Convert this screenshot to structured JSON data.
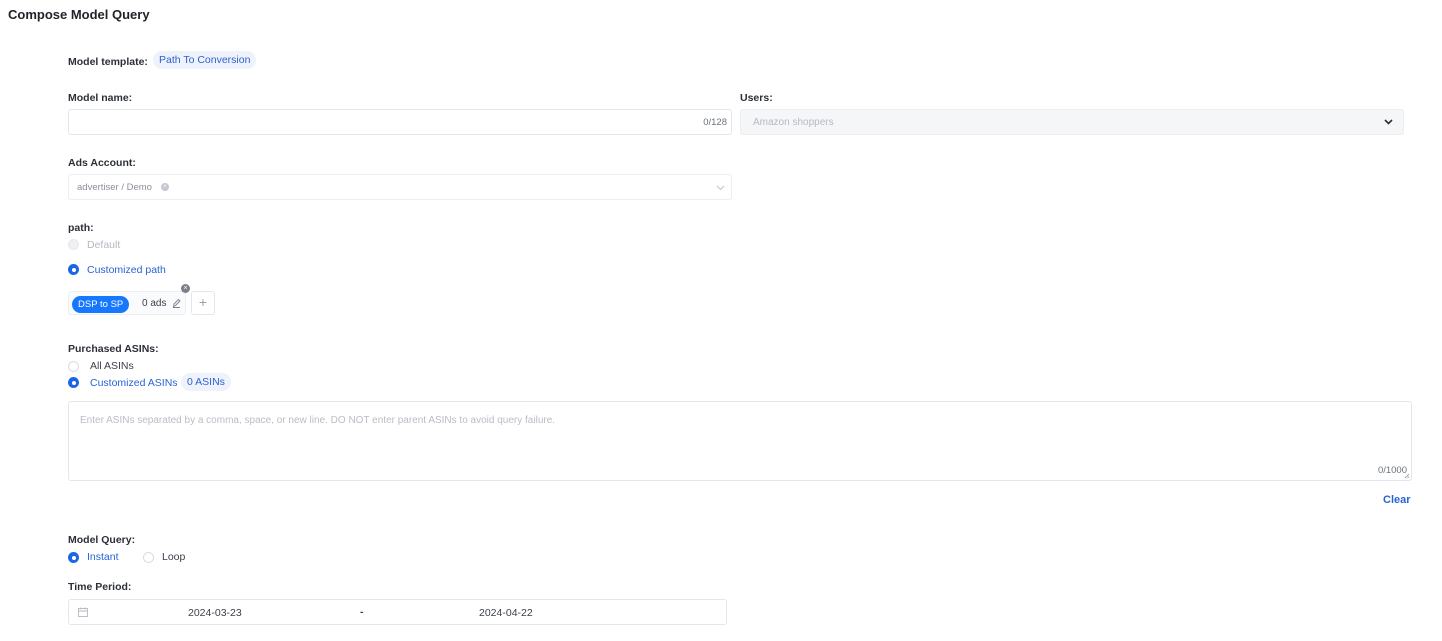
{
  "page": {
    "title": "Compose Model Query"
  },
  "model_template": {
    "label": "Model template:",
    "value": "Path To Conversion"
  },
  "model_name": {
    "label": "Model name:",
    "value": "",
    "counter": "0/128"
  },
  "users": {
    "label": "Users:",
    "value": "Amazon shoppers",
    "icon": "chevron-down-icon"
  },
  "ads_account": {
    "label": "Ads Account:",
    "value": "advertiser / Demo",
    "icon": "chevron-down-icon"
  },
  "path": {
    "label": "path:",
    "options": [
      {
        "label": "Default",
        "selected": false,
        "disabled": true
      },
      {
        "label": "Customized path",
        "selected": true,
        "disabled": false
      }
    ],
    "chip": {
      "tag": "DSP to SP",
      "ads_label": "0 ads"
    },
    "add_label": "+"
  },
  "purchased_asins": {
    "label": "Purchased ASINs:",
    "options": [
      {
        "label": "All ASINs",
        "selected": false
      },
      {
        "label": "Customized ASINs",
        "selected": true
      }
    ],
    "count_badge": "0 ASINs",
    "placeholder": "Enter ASINs separated by a comma, space, or new line. DO NOT enter parent ASINs to avoid query failure.",
    "counter": "0/1000",
    "clear_label": "Clear"
  },
  "model_query": {
    "label": "Model Query:",
    "options": [
      {
        "label": "Instant",
        "selected": true
      },
      {
        "label": "Loop",
        "selected": false
      }
    ]
  },
  "time_period": {
    "label": "Time Period:",
    "start": "2024-03-23",
    "separator": "-",
    "end": "2024-04-22"
  },
  "colors": {
    "accent": "#1c66e5",
    "chip": "#1677ff",
    "link": "#2a63d4"
  }
}
